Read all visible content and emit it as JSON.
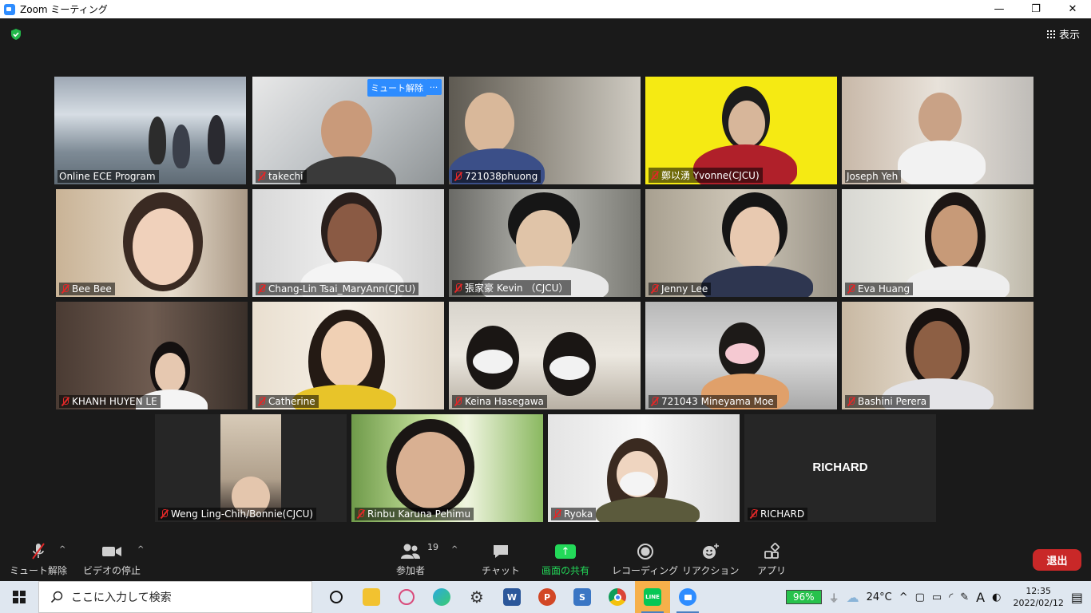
{
  "window": {
    "title": "Zoom ミーティング",
    "minimize": "—",
    "maximize": "❐",
    "close": "✕"
  },
  "header": {
    "view_label": "表示"
  },
  "participants": [
    {
      "name": "Online ECE Program",
      "muted": false,
      "active": true
    },
    {
      "name": "takechi",
      "muted": true,
      "unmute_label": "ミュート解除",
      "more_label": "···"
    },
    {
      "name": "721038phuong",
      "muted": true
    },
    {
      "name": "鄭以湧 Yvonne(CJCU)",
      "muted": true
    },
    {
      "name": "Joseph Yeh",
      "muted": false
    },
    {
      "name": "Bee Bee",
      "muted": true
    },
    {
      "name": "Chang-Lin Tsai_MaryAnn(CJCU)",
      "muted": true
    },
    {
      "name": "張家豪 Kevin （CJCU）",
      "muted": true
    },
    {
      "name": "Jenny Lee",
      "muted": true
    },
    {
      "name": "Eva Huang",
      "muted": true
    },
    {
      "name": "KHANH HUYEN LE",
      "muted": true
    },
    {
      "name": "Catherine",
      "muted": true
    },
    {
      "name": "Keina Hasegawa",
      "muted": true
    },
    {
      "name": "721043 Mineyama Moe",
      "muted": true
    },
    {
      "name": "Bashini Perera",
      "muted": true
    },
    {
      "name": "Weng Ling-Chih/Bonnie(CJCU)",
      "muted": true
    },
    {
      "name": "Rinbu Karuna Pehimu",
      "muted": true
    },
    {
      "name": "Ryoka",
      "muted": true
    },
    {
      "name": "RICHARD",
      "muted": true,
      "video_off_name": "RICHARD"
    }
  ],
  "toolbar": {
    "unmute": "ミュート解除",
    "stop_video": "ビデオの停止",
    "participants": "参加者",
    "participant_count": "19",
    "chat": "チャット",
    "share_screen": "画面の共有",
    "recording": "レコーディング",
    "reactions": "リアクション",
    "apps": "アプリ",
    "leave": "退出"
  },
  "taskbar": {
    "search_placeholder": "ここに入力して検索",
    "battery": "96%",
    "temperature": "24°C",
    "ime": "A",
    "time": "12:35",
    "date": "2022/02/12"
  }
}
